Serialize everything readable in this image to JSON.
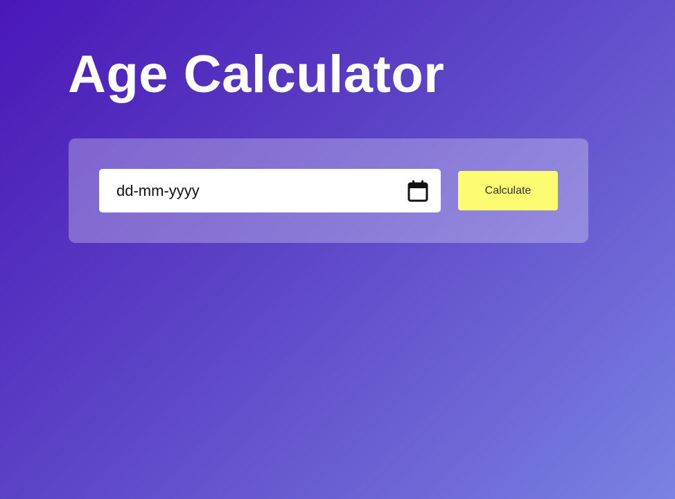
{
  "page": {
    "title": "Age Calculator"
  },
  "form": {
    "date_placeholder": "dd-mm-yyyy",
    "date_value": "",
    "calculate_label": "Calculate"
  },
  "icons": {
    "calendar": "calendar-icon"
  },
  "colors": {
    "background_start": "#4a17b8",
    "background_end": "#7a82e2",
    "button": "#fdfb72",
    "title_text": "#ffffff"
  }
}
